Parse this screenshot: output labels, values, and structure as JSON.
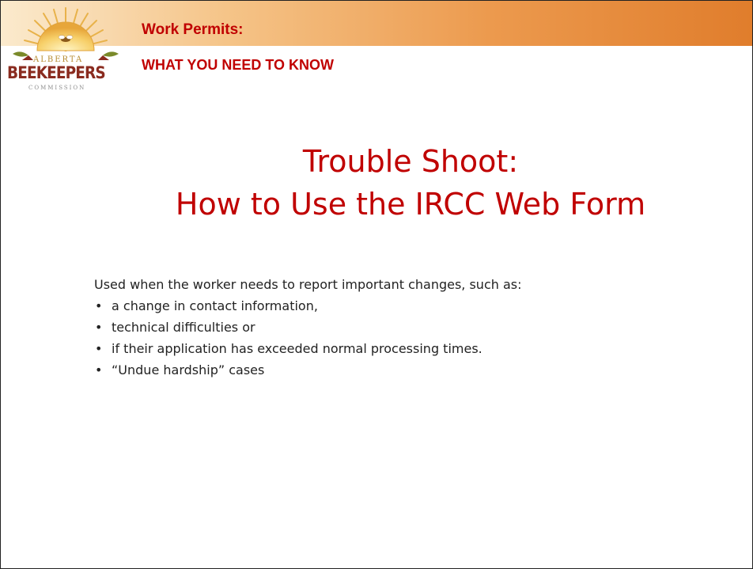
{
  "logo": {
    "top_text": "ALBERTA",
    "main_text": "BEEKEEPERS",
    "sub_text": "COMMISSION"
  },
  "header": {
    "title": "Work Permits:",
    "subtitle": "WHAT YOU NEED TO KNOW"
  },
  "slide": {
    "title_line1": "Trouble Shoot:",
    "title_line2": "How to Use the  IRCC Web Form",
    "intro": "Used when the worker needs to report important changes, such as:",
    "bullet_char": "•",
    "bullets": [
      "a change in contact information,",
      "technical difficulties or",
      "if their application has exceeded normal processing times.",
      "“Undue hardship” cases"
    ]
  },
  "colors": {
    "title_red": "#c00000",
    "band_start": "#fbeacd",
    "band_end": "#e07d2c",
    "logo_maroon": "#8a2b1f"
  }
}
